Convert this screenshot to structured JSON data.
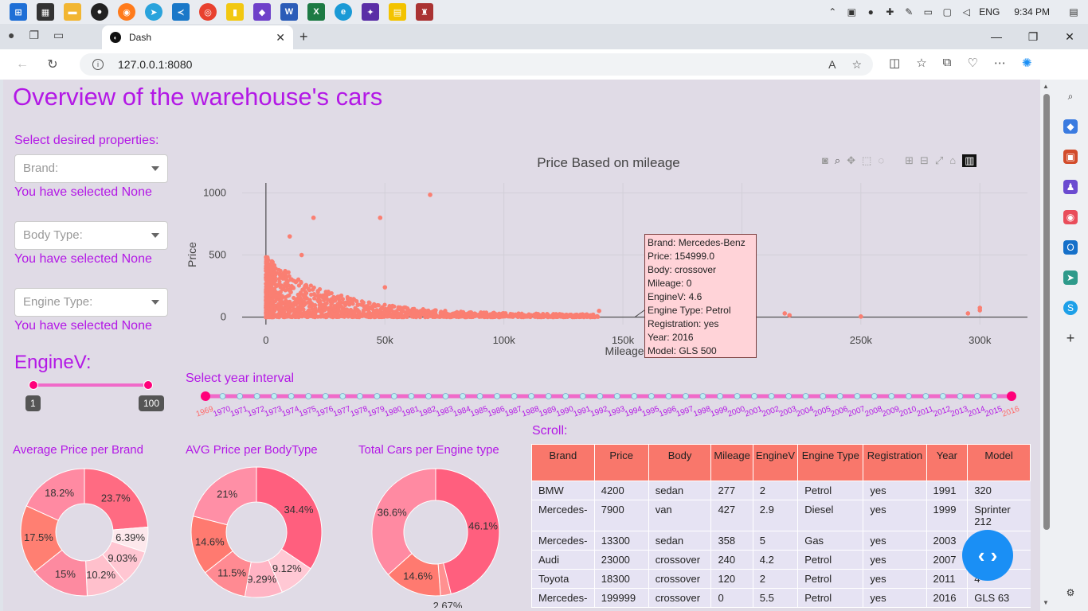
{
  "taskbar": {
    "lang": "ENG",
    "time": "9:34 PM"
  },
  "browser": {
    "tab_title": "Dash",
    "url": "127.0.0.1:8080"
  },
  "page": {
    "title": "Overview of the warehouse's cars",
    "select_label": "Select desired properties:",
    "brand_placeholder": "Brand:",
    "body_placeholder": "Body Type:",
    "engine_placeholder": "Engine Type:",
    "brand_selected": "You have selected None",
    "body_selected": "You have selected None",
    "engine_selected": "You have selected None",
    "enginev_label": "EngineV:",
    "enginev_min": "1",
    "enginev_max": "100",
    "year_label": "Select year interval",
    "scroll_label": "Scroll:"
  },
  "scatter": {
    "title": "Price Based on mileage",
    "xlabel": "Mileage",
    "ylabel": "Price",
    "xticks": [
      "0",
      "50k",
      "100k",
      "150k",
      "250k",
      "300k"
    ],
    "yticks": [
      "0",
      "500",
      "1000"
    ],
    "tooltip": [
      "Brand: Mercedes-Benz",
      "Price: 154999.0",
      "Body: crossover",
      "Mileage: 0",
      "EngineV: 4.6",
      "Engine Type: Petrol",
      "Registration: yes",
      "Year: 2016",
      "Model: GLS 500"
    ]
  },
  "years": [
    "1969",
    "1970",
    "1971",
    "1972",
    "1973",
    "1974",
    "1975",
    "1976",
    "1977",
    "1978",
    "1979",
    "1980",
    "1981",
    "1982",
    "1983",
    "1984",
    "1985",
    "1986",
    "1987",
    "1988",
    "1989",
    "1990",
    "1991",
    "1992",
    "1993",
    "1994",
    "1995",
    "1996",
    "1997",
    "1998",
    "1999",
    "2000",
    "2001",
    "2002",
    "2003",
    "2004",
    "2005",
    "2006",
    "2007",
    "2008",
    "2009",
    "2010",
    "2011",
    "2012",
    "2013",
    "2014",
    "2015",
    "2016"
  ],
  "chart_data": [
    {
      "type": "scatter",
      "title": "Price Based on mileage",
      "xlabel": "Mileage",
      "ylabel": "Price",
      "xlim": [
        -10,
        320
      ],
      "ylim": [
        -60,
        1080
      ],
      "note_points": [
        [
          0,
          0
        ],
        [
          10,
          650
        ],
        [
          15,
          500
        ],
        [
          20,
          800
        ],
        [
          48,
          800
        ],
        [
          69,
          985
        ],
        [
          50,
          240
        ],
        [
          100,
          10
        ],
        [
          140,
          50
        ],
        [
          218,
          30
        ],
        [
          220,
          15
        ],
        [
          250,
          5
        ],
        [
          295,
          30
        ],
        [
          300,
          55
        ],
        [
          300,
          75
        ]
      ],
      "color": "#fa7f72"
    },
    {
      "type": "pie",
      "title": "Average Price per Brand",
      "values": [
        23.7,
        6.39,
        9.03,
        10.2,
        15,
        17.5,
        18.2
      ],
      "labels": [
        "23.7%",
        "6.39%",
        "9.03%",
        "10.2%",
        "15%",
        "17.5%",
        "18.2%"
      ],
      "colors": [
        "#ff6b82",
        "#fde8ec",
        "#ffc6d2",
        "#ffc0cc",
        "#fd8aa0",
        "#ff7f72",
        "#ff8aa2"
      ]
    },
    {
      "type": "pie",
      "title": "AVG Price per BodyType",
      "values": [
        34.4,
        9.12,
        9.29,
        11.5,
        14.6,
        21
      ],
      "labels": [
        "34.4%",
        "9.12%",
        "9.29%",
        "11.5%",
        "14.6%",
        "21%"
      ],
      "colors": [
        "#ff5f7e",
        "#ffc8d4",
        "#ffb4c4",
        "#ff8a92",
        "#ff7a70",
        "#ff8fa6"
      ]
    },
    {
      "type": "pie",
      "title": "Total Cars per Engine type",
      "values": [
        46.1,
        2.67,
        14.6,
        36.6
      ],
      "labels": [
        "46.1%",
        "2.67%",
        "14.6%",
        "36.6%"
      ],
      "colors": [
        "#ff5f7e",
        "#ff9090",
        "#ff7a70",
        "#ff8aa2"
      ]
    }
  ],
  "table": {
    "headers": [
      "Brand",
      "Price",
      "Body",
      "Mileage",
      "EngineV",
      "Engine Type",
      "Registration",
      "Year",
      "Model"
    ],
    "rows": [
      [
        "BMW",
        "4200",
        "sedan",
        "277",
        "2",
        "Petrol",
        "yes",
        "1991",
        "320"
      ],
      [
        "Mercedes-",
        "7900",
        "van",
        "427",
        "2.9",
        "Diesel",
        "yes",
        "1999",
        "Sprinter 212"
      ],
      [
        "Mercedes-",
        "13300",
        "sedan",
        "358",
        "5",
        "Gas",
        "yes",
        "2003",
        ""
      ],
      [
        "Audi",
        "23000",
        "crossover",
        "240",
        "4.2",
        "Petrol",
        "yes",
        "2007",
        ""
      ],
      [
        "Toyota",
        "18300",
        "crossover",
        "120",
        "2",
        "Petrol",
        "yes",
        "2011",
        "4"
      ],
      [
        "Mercedes-",
        "199999",
        "crossover",
        "0",
        "5.5",
        "Petrol",
        "yes",
        "2016",
        "GLS 63"
      ]
    ]
  }
}
